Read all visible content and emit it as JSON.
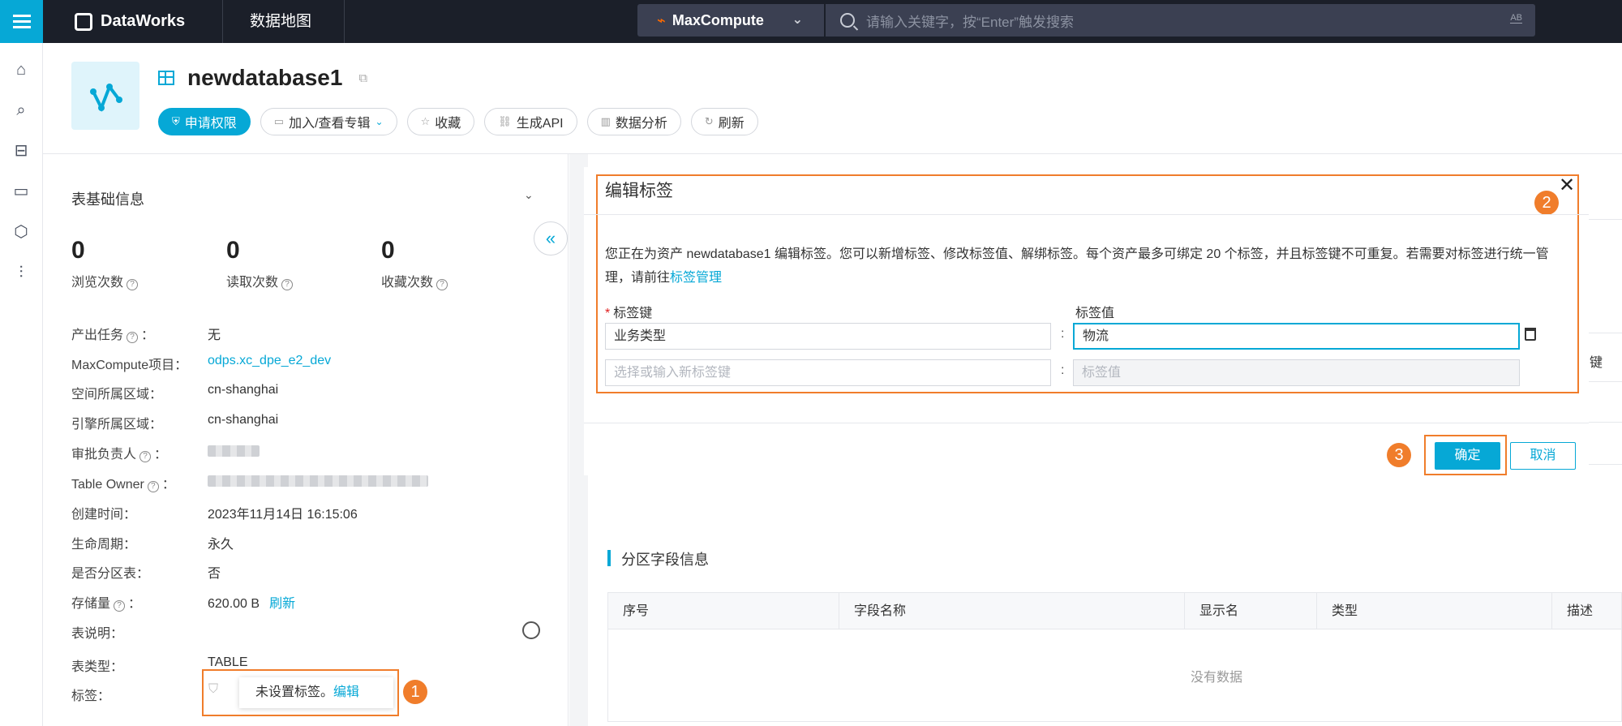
{
  "topbar": {
    "brand": "DataWorks",
    "module": "数据地图",
    "engine": "MaxCompute",
    "search_placeholder": "请输入关键字，按“Enter”触发搜索",
    "search_ab": "AB"
  },
  "rail": {
    "items": [
      "home-icon",
      "search-data-icon",
      "toolbox-icon",
      "monitor-icon",
      "cube-icon",
      "settings-sliders-icon"
    ]
  },
  "header": {
    "asset_name": "newdatabase1",
    "actions": [
      {
        "label": "申请权限",
        "icon": "shield-icon",
        "primary": true
      },
      {
        "label": "加入/查看专辑",
        "icon": "album-icon",
        "dropdown": true
      },
      {
        "label": "收藏",
        "icon": "star-icon"
      },
      {
        "label": "生成API",
        "icon": "link-icon"
      },
      {
        "label": "数据分析",
        "icon": "chart-icon"
      },
      {
        "label": "刷新",
        "icon": "refresh-icon"
      }
    ]
  },
  "basic": {
    "title": "表基础信息",
    "stats": [
      {
        "value": "0",
        "label": "浏览次数"
      },
      {
        "value": "0",
        "label": "读取次数"
      },
      {
        "value": "0",
        "label": "收藏次数"
      }
    ],
    "fields": [
      {
        "label": "产出任务",
        "help": true,
        "value": "无"
      },
      {
        "label": "MaxCompute项目：",
        "value": "odps.xc_dpe_e2_dev",
        "link": true
      },
      {
        "label": "空间所属区域：",
        "value": "cn-shanghai"
      },
      {
        "label": "引擎所属区域：",
        "value": "cn-shanghai"
      },
      {
        "label": "审批负责人",
        "help": true,
        "value": ""
      },
      {
        "label": "Table Owner",
        "help": true,
        "value": ""
      },
      {
        "label": "创建时间：",
        "value": "2023年11月14日 16:15:06"
      },
      {
        "label": "生命周期：",
        "value": "永久"
      },
      {
        "label": "是否分区表：",
        "value": "否"
      },
      {
        "label": "存储量",
        "help": true,
        "value": "620.00 B"
      },
      {
        "label": "表说明：",
        "value": ""
      },
      {
        "label": "表类型：",
        "value": "TABLE"
      },
      {
        "label": "标签：",
        "value": ""
      }
    ],
    "storage_refresh": "刷新",
    "tag_tip": "未设置标签。",
    "tag_edit": "编辑"
  },
  "dialog": {
    "title": "编辑标签",
    "desc_prefix": "您正在为资产 newdatabase1 编辑标签。您可以新增标签、修改标签值、解绑标签。每个资产最多可绑定 20 个标签，并且标签键不可重复。若需要对标签进行统一管理，请前往",
    "desc_link": "标签管理",
    "key_header": "标签键",
    "value_header": "标签值",
    "rows": [
      {
        "key": "业务类型",
        "value": "物流"
      }
    ],
    "new_key_placeholder": "选择或输入新标签键",
    "new_value_placeholder": "标签值",
    "ok": "确定",
    "cancel": "取消"
  },
  "badges": [
    "1",
    "2",
    "3"
  ],
  "right_stub": "键",
  "partition": {
    "title": "分区字段信息",
    "columns": [
      "序号",
      "字段名称",
      "显示名",
      "类型",
      "描述"
    ],
    "empty": "没有数据"
  },
  "colors": {
    "accent": "#06a8d6",
    "highlight": "#f07d2b",
    "topbar": "#1b1f29"
  }
}
